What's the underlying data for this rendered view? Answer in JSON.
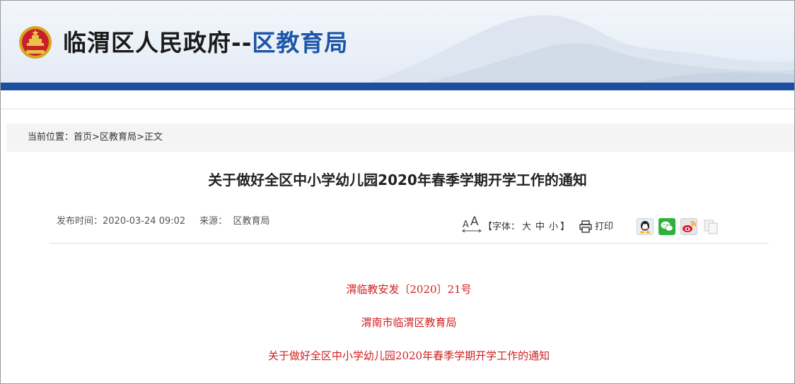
{
  "header": {
    "title_part1": "临渭区人民政府",
    "title_sep": "--",
    "title_part2": "区教育局",
    "colors": {
      "blue_bar": "#1c4fa0",
      "dept_title": "#1b56a8"
    },
    "emblem_icon": "national-emblem-icon"
  },
  "breadcrumb": {
    "prefix": "当前位置：",
    "home": "首页",
    "sep1": ">",
    "section": "区教育局",
    "sep2": ">",
    "current": "正文"
  },
  "article": {
    "title": "关于做好全区中小学幼儿园2020年春季学期开学工作的通知",
    "publish_label": "发布时间：",
    "publish_time": "2020-03-24 09:02",
    "source_label": "来源：",
    "source": "区教育局"
  },
  "tools": {
    "font_prefix": "【字体：",
    "font_large": "大",
    "font_medium": "中",
    "font_small": "小",
    "font_suffix": "】",
    "print_label": "打印",
    "share_icons": [
      "qq-icon",
      "wechat-icon",
      "weibo-icon",
      "copy-icon"
    ]
  },
  "body": {
    "doc_number": "渭临教安发〔2020〕21号",
    "issuer": "渭南市临渭区教育局",
    "doc_title": "关于做好全区中小学幼儿园2020年春季学期开学工作的通知",
    "text_color": "#d21f1f"
  }
}
